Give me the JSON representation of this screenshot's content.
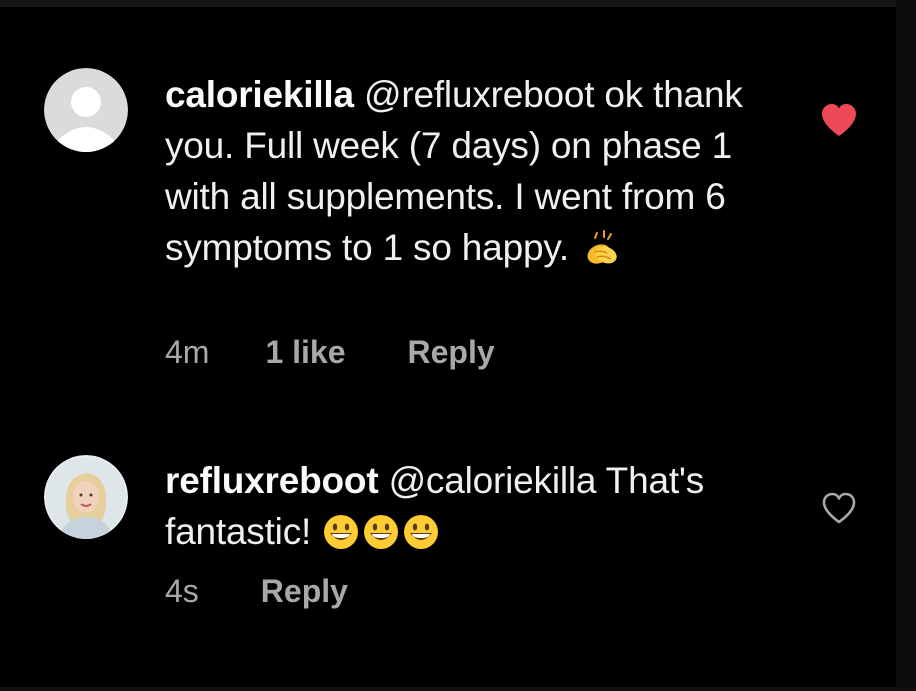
{
  "comments": [
    {
      "username": "caloriekilla",
      "text": "@refluxreboot ok thank you. Full week (7 days) on phase 1 with all supplements. I went from 6 symptoms to 1 so happy.",
      "emoji": "clapping-hands-emoji",
      "time": "4m",
      "likes": "1 like",
      "reply_label": "Reply",
      "liked": true,
      "like_icon": "heart-filled-icon",
      "like_color": "#ed4956",
      "avatar": "default-avatar-icon"
    },
    {
      "username": "refluxreboot",
      "text": "@caloriekilla That's fantastic!",
      "emoji": "grinning-face-emoji x3",
      "time": "4s",
      "reply_label": "Reply",
      "liked": false,
      "like_icon": "heart-outline-icon",
      "like_color": "#a8a8a8",
      "avatar": "profile-photo"
    }
  ],
  "colors": {
    "background": "#000000",
    "text": "#f0f0f0",
    "meta_text": "#a8a8a8",
    "like_active": "#ed4956"
  }
}
